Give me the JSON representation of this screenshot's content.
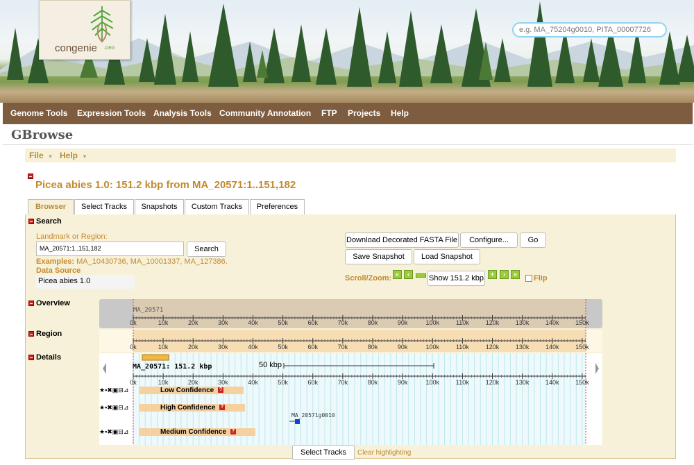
{
  "header": {
    "logo_text": "congenie",
    "logo_suffix": ".ORG",
    "search_placeholder": "e.g. MA_75204g0010, PITA_00007726"
  },
  "nav": {
    "items": [
      "Genome Tools",
      "Expression Tools",
      "Analysis Tools",
      "Community Annotation",
      "FTP",
      "Projects",
      "Help"
    ]
  },
  "page": {
    "app_title": "GBrowse",
    "heading": "Picea abies 1.0: 151.2 kbp from MA_20571:1..151,182"
  },
  "menubar": {
    "file": "File",
    "help": "Help"
  },
  "tabs": [
    "Browser",
    "Select Tracks",
    "Snapshots",
    "Custom Tracks",
    "Preferences"
  ],
  "search": {
    "section_title": "Search",
    "landmark_label": "Landmark or Region:",
    "landmark_value": "MA_20571:1..151,182",
    "search_button": "Search",
    "examples_label": "Examples:",
    "examples": "MA_10430736, MA_10001337, MA_127386.",
    "datasource_label": "Data Source",
    "datasource_value": "Picea abies 1.0",
    "download_button": "Download Decorated FASTA File",
    "configure_button": "Configure...",
    "go_button": "Go",
    "save_snapshot": "Save Snapshot",
    "load_snapshot": "Load Snapshot",
    "scroll_zoom_label": "Scroll/Zoom:",
    "show_button": "Show 151.2 kbp",
    "flip_label": "Flip",
    "flip_checked": false
  },
  "sections": {
    "overview": "Overview",
    "region": "Region",
    "details": "Details"
  },
  "tracks": {
    "overview_name": "MA_20571",
    "details_title": "MA_20571: 151.2 kbp",
    "scale_label": "50 kbp",
    "ticks": [
      "0k",
      "10k",
      "20k",
      "30k",
      "40k",
      "50k",
      "60k",
      "70k",
      "80k",
      "90k",
      "100k",
      "110k",
      "120k",
      "130k",
      "140k",
      "150k"
    ],
    "low": "Low Confidence",
    "high": "High Confidence",
    "medium": "Medium Confidence",
    "feature_label": "MA_20571g0010"
  },
  "footer": {
    "select_tracks": "Select Tracks",
    "clear_highlighting": "Clear highlighting"
  },
  "colors": {
    "nav_bg": "#7d5c3f",
    "accent_gold": "#c28a2e",
    "panel_bg": "#f8f1d9",
    "overview_bg": "#dccbb3",
    "details_stripe": "#bfe6ee"
  }
}
